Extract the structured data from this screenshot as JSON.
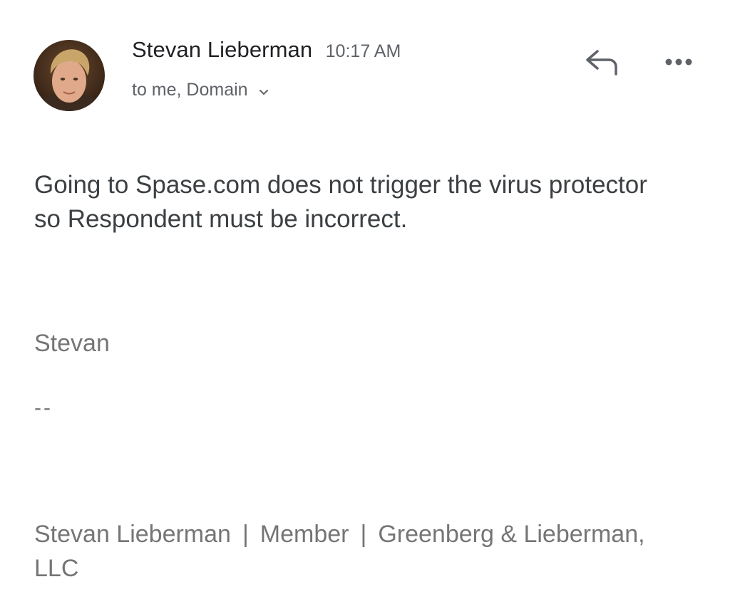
{
  "email": {
    "sender_name": "Stevan Lieberman",
    "time": "10:17 AM",
    "recipients": "to me, Domain",
    "body": "Going to Spase.com does not trigger the virus protector so Respondent must be incorrect.",
    "signoff": "Stevan",
    "separator": "--",
    "signature": {
      "name": "Stevan Lieberman",
      "divider": "|",
      "role": "Member",
      "firm": "Greenberg & Lieberman, LLC"
    }
  },
  "icons": {
    "avatar": "avatar-photo",
    "reply": "reply-icon",
    "more": "more-options-icon",
    "expand": "chevron-down-icon"
  },
  "colors": {
    "primary_text": "#202124",
    "secondary_text": "#5f6368",
    "muted_text": "#757575",
    "icon": "#5f6368"
  }
}
